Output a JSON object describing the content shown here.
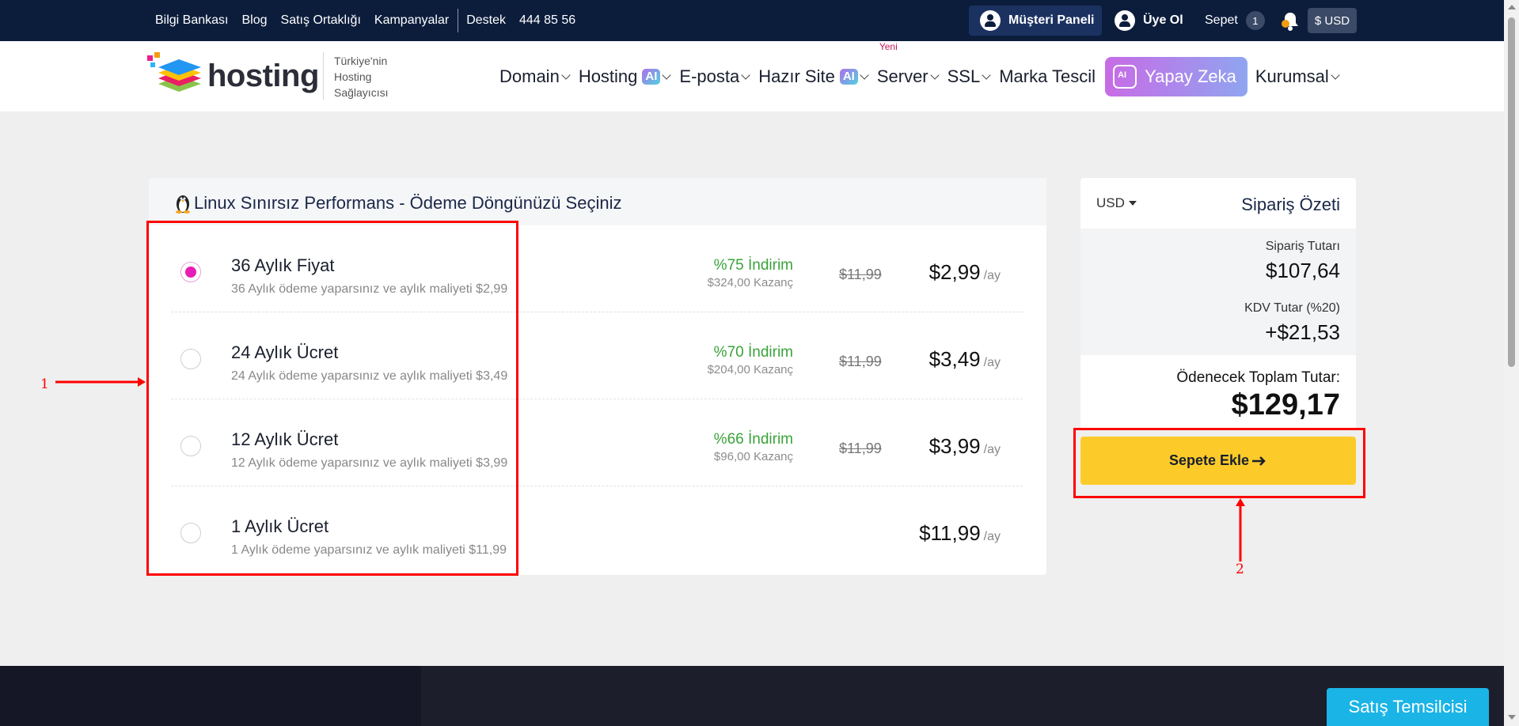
{
  "topbar": {
    "links": [
      "Bilgi Bankası",
      "Blog",
      "Satış Ortaklığı",
      "Kampanyalar"
    ],
    "destek": "Destek",
    "phone": "444 85 56",
    "panel_label": "Müşteri Paneli",
    "register_label": "Üye Ol",
    "cart_label": "Sepet",
    "cart_count": "1",
    "currency_label": "$ USD"
  },
  "nav": {
    "logo_text": "hosting",
    "tagline": [
      "Türkiye'nin",
      "Hosting",
      "Sağlayıcısı"
    ],
    "items": {
      "domain": "Domain",
      "hosting": "Hosting",
      "eposta": "E-posta",
      "hazir_site": "Hazır Site",
      "server": "Server",
      "ssl": "SSL",
      "marka": "Marka Tescil",
      "yapay_zeka": "Yapay Zeka",
      "kurumsal": "Kurumsal"
    },
    "ai_badge": "AI",
    "new_badge": "Yeni"
  },
  "main": {
    "title": "Linux Sınırsız Performans - Ödeme Döngünüzü Seçiniz",
    "plans": [
      {
        "name": "36 Aylık Fiyat",
        "desc": "36 Aylık ödeme yaparsınız ve aylık maliyeti $2,99",
        "discount": "%75 İndirim",
        "saving": "$324,00 Kazanç",
        "old_price": "$11,99",
        "price": "$2,99",
        "unit": "/ay",
        "selected": true
      },
      {
        "name": "24 Aylık Ücret",
        "desc": "24 Aylık ödeme yaparsınız ve aylık maliyeti $3,49",
        "discount": "%70 İndirim",
        "saving": "$204,00 Kazanç",
        "old_price": "$11,99",
        "price": "$3,49",
        "unit": "/ay",
        "selected": false
      },
      {
        "name": "12 Aylık Ücret",
        "desc": "12 Aylık ödeme yaparsınız ve aylık maliyeti $3,99",
        "discount": "%66 İndirim",
        "saving": "$96,00 Kazanç",
        "old_price": "$11,99",
        "price": "$3,99",
        "unit": "/ay",
        "selected": false
      },
      {
        "name": "1 Aylık Ücret",
        "desc": "1 Aylık ödeme yaparsınız ve aylık maliyeti $11,99",
        "discount": "",
        "saving": "",
        "old_price": "",
        "price": "$11,99",
        "unit": "/ay",
        "selected": false
      }
    ]
  },
  "summary": {
    "currency": "USD",
    "title": "Sipariş Özeti",
    "order_label": "Sipariş Tutarı",
    "order_value": "$107,64",
    "tax_label": "KDV Tutar (%20)",
    "tax_value": "+$21,53",
    "total_label": "Ödenecek Toplam Tutar:",
    "total_value": "$129,17",
    "add_button": "Sepete Ekle"
  },
  "annotations": {
    "one": "1",
    "two": "2"
  },
  "footer": {
    "sales_rep": "Satış Temsilcisi"
  },
  "colors": {
    "topbar": "#0c1d3c",
    "accent_pink": "#e81cb6",
    "discount_green": "#3aa33a",
    "cta_yellow": "#fccb2a",
    "annotation_red": "#ff0000"
  }
}
